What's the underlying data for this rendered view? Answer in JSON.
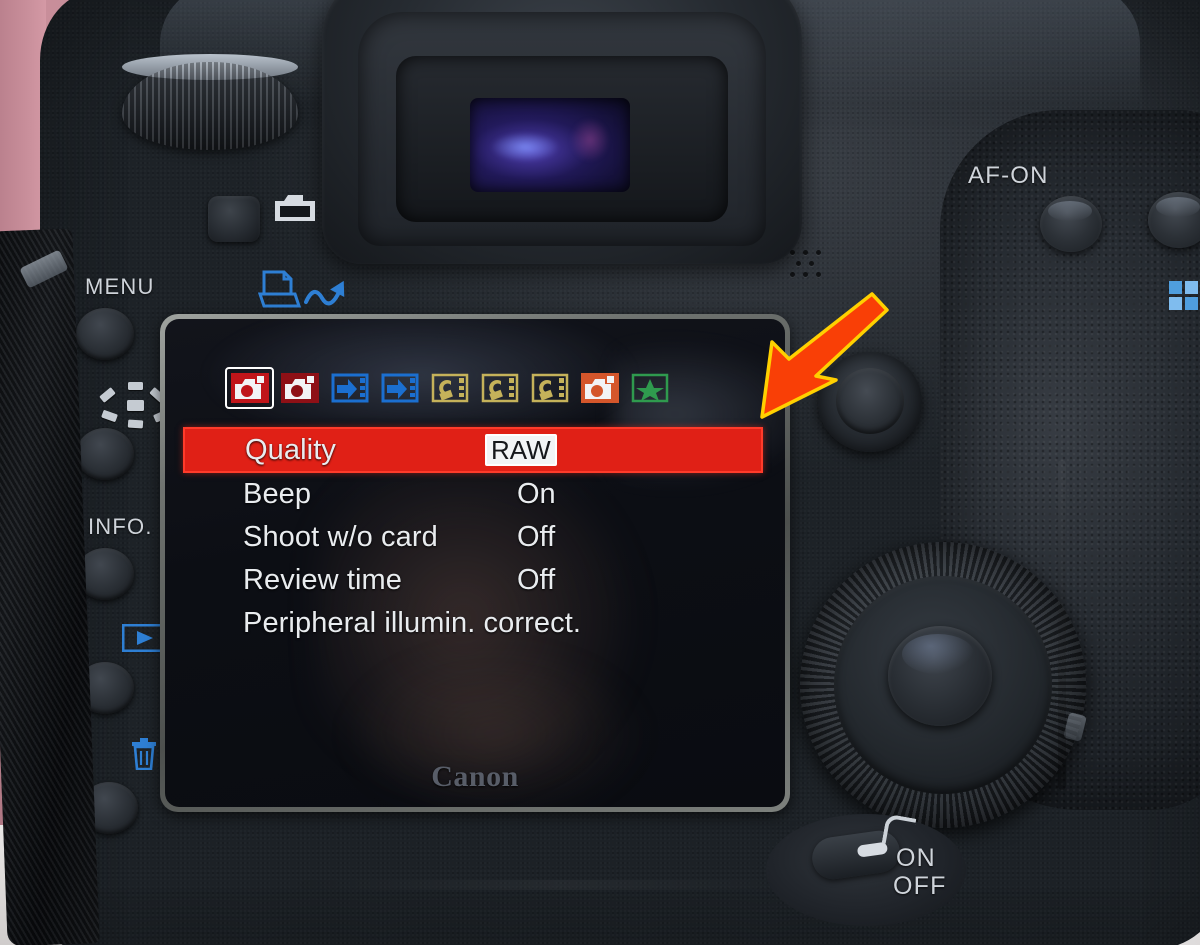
{
  "scene": {
    "subject": "Canon EOS DSLR camera rear panel",
    "background_colors": {
      "curtain_pink": "#c9909c",
      "wall_white": "#efeeee",
      "body_dark": "#23282e"
    }
  },
  "body_labels": {
    "menu": "MENU",
    "info": "INFO.",
    "af_on": "AF-ON",
    "power_on": "ON",
    "power_off": "OFF"
  },
  "body_icons": {
    "camera_top": "camera-icon",
    "print_share": "print-share-icon",
    "picture_style": "picture-style-icon",
    "playback": "playback-icon",
    "trash": "trash-icon",
    "index": "index-grid-icon",
    "multi_controller": "multi-controller-icon",
    "quick_control_dial": "quick-control-dial-icon",
    "set_button": "set-button-icon"
  },
  "lcd": {
    "brand": "Canon",
    "tabs": [
      {
        "name": "shooting-1",
        "glyph": "camera-icon",
        "color": "#c0151a",
        "selected": true
      },
      {
        "name": "shooting-2",
        "glyph": "camera-icon",
        "color": "#8e1016",
        "selected": false
      },
      {
        "name": "playback-1",
        "glyph": "playback-icon",
        "color": "#1b6fd0",
        "selected": false
      },
      {
        "name": "playback-2",
        "glyph": "playback-icon",
        "color": "#1b6fd0",
        "selected": false
      },
      {
        "name": "setup-1",
        "glyph": "wrench-icon",
        "color": "#c5b25a",
        "selected": false
      },
      {
        "name": "setup-2",
        "glyph": "wrench-icon",
        "color": "#c5b25a",
        "selected": false
      },
      {
        "name": "setup-3",
        "glyph": "wrench-icon",
        "color": "#c5b25a",
        "selected": false
      },
      {
        "name": "custom-functions",
        "glyph": "camera-icon",
        "color": "#d4562b",
        "selected": false
      },
      {
        "name": "my-menu",
        "glyph": "star-icon",
        "color": "#2f9a4e",
        "selected": false
      }
    ],
    "menu_items": [
      {
        "label": "Quality",
        "value": "RAW",
        "highlighted": true
      },
      {
        "label": "Beep",
        "value": "On",
        "highlighted": false
      },
      {
        "label": "Shoot w/o card",
        "value": "Off",
        "highlighted": false
      },
      {
        "label": "Review time",
        "value": "Off",
        "highlighted": false
      },
      {
        "label": "Peripheral illumin. correct.",
        "value": "",
        "highlighted": false
      }
    ],
    "highlight_color": "#e02016",
    "text_color": "#e9ecef"
  },
  "annotation": {
    "type": "arrow",
    "fill": "#f93f06",
    "stroke": "#ffd000",
    "points_to": "lcd-top-right-corner"
  }
}
